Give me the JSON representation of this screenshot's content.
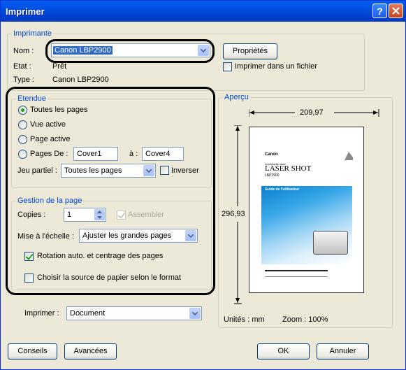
{
  "window": {
    "title": "Imprimer"
  },
  "printer": {
    "group_label": "Imprimante",
    "name_label": "Nom :",
    "name_value": "Canon LBP2900",
    "state_label": "Etat :",
    "state_value": "Prêt",
    "type_label": "Type :",
    "type_value": "Canon LBP2900",
    "properties_button": "Propriétés",
    "print_to_file": "Imprimer dans un fichier"
  },
  "range": {
    "group_label": "Etendue",
    "all_pages": "Toutes les pages",
    "current_view": "Vue active",
    "current_page": "Page active",
    "pages_label": "Pages De :",
    "pages_from": "Cover1",
    "pages_to_label": "à :",
    "pages_to": "Cover4",
    "subset_label": "Jeu partiel :",
    "subset_value": "Toutes les pages",
    "reverse": "Inverser"
  },
  "page_handling": {
    "group_label": "Gestion de la page",
    "copies_label": "Copies :",
    "copies_value": "1",
    "collate": "Assembler",
    "scaling_label": "Mise à l'échelle :",
    "scaling_value": "Ajuster les grandes pages",
    "auto_rotate": "Rotation auto. et centrage des pages",
    "choose_source": "Choisir la source de papier selon le format"
  },
  "preview": {
    "group_label": "Aperçu",
    "width_value": "209,97",
    "height_value": "296,93",
    "units": "Unités : mm",
    "zoom": "Zoom : 100%",
    "doc_brand": "Canon",
    "doc_subtitle": "Imprimante laser",
    "doc_title": "LASER SHOT",
    "doc_model": "LBP2900",
    "doc_banner": "Guide de l'utilisateur"
  },
  "print_what": {
    "label": "Imprimer :",
    "value": "Document"
  },
  "footer": {
    "tips_button": "Conseils",
    "advanced_button": "Avancées",
    "ok_button": "OK",
    "cancel_button": "Annuler"
  },
  "colors": {
    "title_bar": "#0054E3",
    "group_label": "#0046D5",
    "dialog_bg": "#ECE9D8"
  }
}
